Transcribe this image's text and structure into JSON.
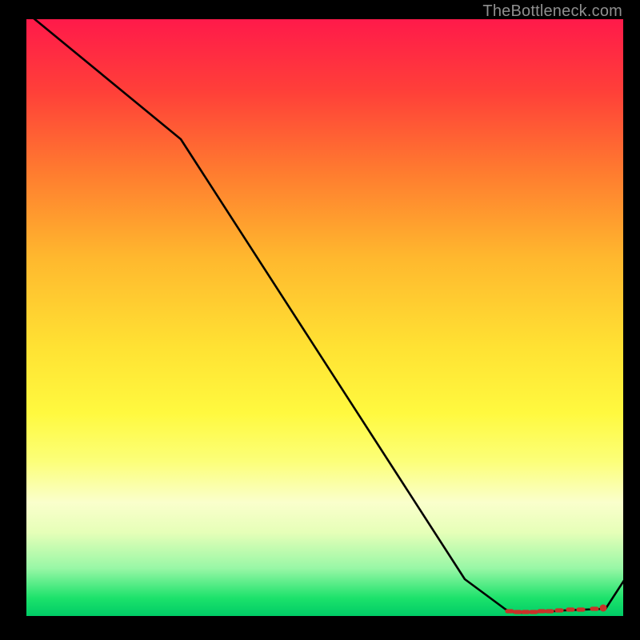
{
  "attribution": "TheBottleneck.com",
  "chart_data": {
    "type": "line",
    "title": "",
    "xlabel": "",
    "ylabel": "",
    "xlim": [
      0,
      100
    ],
    "ylim": [
      0,
      100
    ],
    "gradient_bands": [
      {
        "name": "red-high",
        "color": "#ff1a4a"
      },
      {
        "name": "orange-mid",
        "color": "#ffb82e"
      },
      {
        "name": "yellow-low",
        "color": "#fff93f"
      },
      {
        "name": "green-optimal",
        "color": "#00cc66"
      }
    ],
    "series": [
      {
        "name": "bottleneck-curve",
        "color": "#000000",
        "x": [
          0,
          26,
          73,
          80,
          83,
          86,
          89,
          92,
          97,
          100
        ],
        "values": [
          100,
          80,
          6,
          1,
          0.6,
          0.6,
          0.7,
          0.8,
          0.8,
          6
        ]
      },
      {
        "name": "optimal-markers",
        "color": "#cc2b2b",
        "type": "marker-dashes",
        "x": [
          80,
          81,
          82,
          83,
          84,
          85,
          86,
          87,
          88,
          89,
          90,
          91,
          92,
          93,
          94,
          95,
          96,
          97
        ],
        "values": [
          0.9,
          0.9,
          0.9,
          0.9,
          0.9,
          0.9,
          0.9,
          0.9,
          0.9,
          0.9,
          0.9,
          0.9,
          0.9,
          0.9,
          0.9,
          0.9,
          0.9,
          0.9
        ]
      }
    ]
  }
}
